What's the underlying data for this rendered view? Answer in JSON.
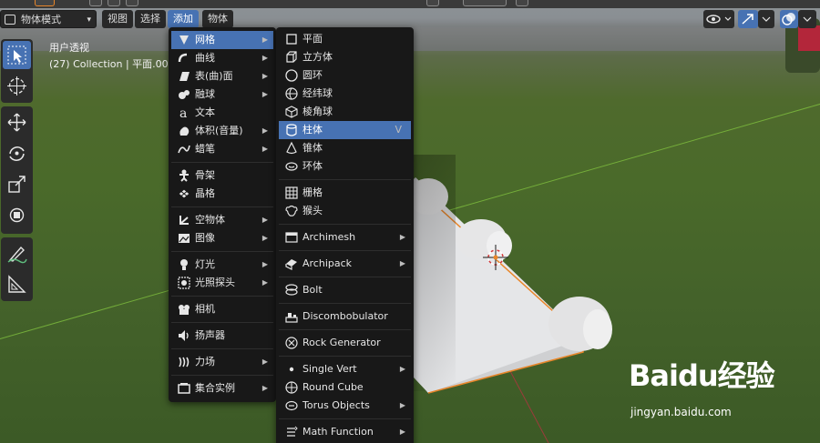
{
  "header": {
    "mode_select": "物体模式",
    "menus": [
      "视图",
      "选择",
      "添加",
      "物体"
    ]
  },
  "viewport": {
    "perspective_label": "用户透视",
    "collection_label": "(27) Collection | 平面.002"
  },
  "add_menu": {
    "items": [
      {
        "label": "网格",
        "icon": "mesh-icon",
        "submenu": true,
        "highlighted": true
      },
      {
        "label": "曲线",
        "icon": "curve-icon",
        "submenu": true
      },
      {
        "label": "表(曲)面",
        "icon": "surface-icon",
        "submenu": true
      },
      {
        "label": "融球",
        "icon": "metaball-icon",
        "submenu": true
      },
      {
        "label": "文本",
        "icon": "text-icon",
        "submenu": false
      },
      {
        "label": "体积(音量)",
        "icon": "volume-icon",
        "submenu": true
      },
      {
        "label": "蜡笔",
        "icon": "grease-pencil-icon",
        "submenu": true
      },
      {
        "label": "骨架",
        "icon": "armature-icon",
        "submenu": false
      },
      {
        "label": "晶格",
        "icon": "lattice-icon",
        "submenu": false
      },
      {
        "label": "空物体",
        "icon": "empty-icon",
        "submenu": true
      },
      {
        "label": "图像",
        "icon": "image-icon",
        "submenu": true
      },
      {
        "label": "灯光",
        "icon": "light-icon",
        "submenu": true
      },
      {
        "label": "光照探头",
        "icon": "light-probe-icon",
        "submenu": true
      },
      {
        "label": "相机",
        "icon": "camera-icon",
        "submenu": false
      },
      {
        "label": "扬声器",
        "icon": "speaker-icon",
        "submenu": false
      },
      {
        "label": "力场",
        "icon": "force-field-icon",
        "submenu": true
      },
      {
        "label": "集合实例",
        "icon": "collection-instance-icon",
        "submenu": true
      }
    ]
  },
  "mesh_menu": {
    "items": [
      {
        "label": "平面",
        "icon": "plane-icon"
      },
      {
        "label": "立方体",
        "icon": "cube-icon"
      },
      {
        "label": "圆环",
        "icon": "circle-icon"
      },
      {
        "label": "经纬球",
        "icon": "uv-sphere-icon"
      },
      {
        "label": "棱角球",
        "icon": "ico-sphere-icon"
      },
      {
        "label": "柱体",
        "icon": "cylinder-icon",
        "highlighted": true,
        "shortcut": "V"
      },
      {
        "label": "锥体",
        "icon": "cone-icon"
      },
      {
        "label": "环体",
        "icon": "torus-icon"
      },
      {
        "label": "栅格",
        "icon": "grid-icon"
      },
      {
        "label": "猴头",
        "icon": "monkey-icon"
      },
      {
        "label": "Archimesh",
        "icon": "archimesh-icon",
        "submenu": true
      },
      {
        "label": "Archipack",
        "icon": "archipack-icon",
        "submenu": true
      },
      {
        "label": "Bolt",
        "icon": "bolt-icon"
      },
      {
        "label": "Discombobulator",
        "icon": "discombobulator-icon"
      },
      {
        "label": "Rock Generator",
        "icon": "rock-icon"
      },
      {
        "label": "Single Vert",
        "icon": "vertex-icon",
        "submenu": true
      },
      {
        "label": "Round Cube",
        "icon": "round-cube-icon"
      },
      {
        "label": "Torus Objects",
        "icon": "torus-objects-icon",
        "submenu": true
      },
      {
        "label": "Math Function",
        "icon": "math-function-icon",
        "submenu": true
      }
    ]
  },
  "watermark": {
    "logo": "Baidu经验",
    "url": "jingyan.baidu.com"
  },
  "colors": {
    "accent": "#4772b3",
    "menu_bg": "#181818",
    "selection_orange": "#e8862a"
  }
}
